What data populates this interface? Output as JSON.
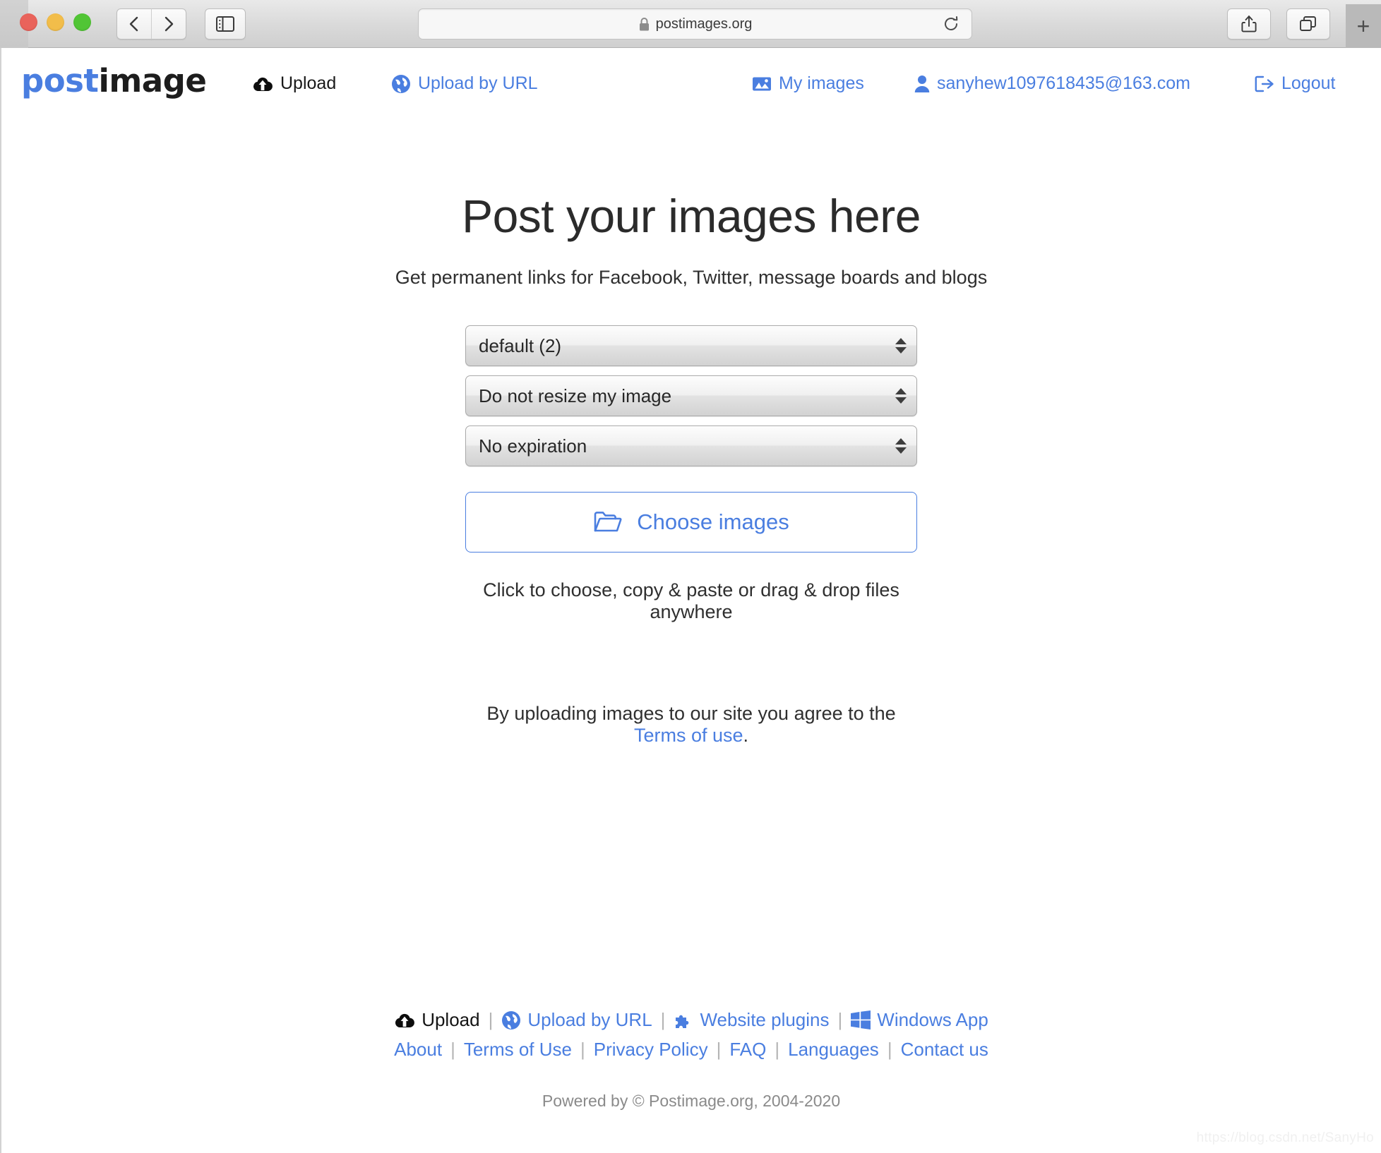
{
  "browser": {
    "url": "postimages.org",
    "lock_icon": "lock-icon",
    "reload_icon": "reload-icon",
    "back_icon": "chevron-left-icon",
    "forward_icon": "chevron-right-icon",
    "sidebar_icon": "sidebar-icon",
    "share_icon": "share-icon",
    "tabs_icon": "tab-overview-icon",
    "newtab_label": "+"
  },
  "header": {
    "logo_part1": "post",
    "logo_part2": "image",
    "nav": [
      {
        "label": "Upload",
        "icon": "cloud-upload-icon",
        "style": "black"
      },
      {
        "label": "Upload by URL",
        "icon": "globe-icon",
        "style": "blue"
      },
      {
        "label": "My images",
        "icon": "photo-icon",
        "style": "blue"
      },
      {
        "label": "sanyhew1097618435@163.com",
        "icon": "user-icon",
        "style": "blue"
      },
      {
        "label": "Logout",
        "icon": "logout-icon",
        "style": "blue"
      }
    ]
  },
  "main": {
    "title": "Post your images here",
    "subtitle": "Get permanent links for Facebook, Twitter, message boards and blogs",
    "selects": [
      {
        "name": "gallery-select",
        "value": "default (2)"
      },
      {
        "name": "resize-select",
        "value": "Do not resize my image"
      },
      {
        "name": "expiration-select",
        "value": "No expiration"
      }
    ],
    "choose_button": {
      "label": "Choose images",
      "icon": "open-folder-icon"
    },
    "drop_hint": "Click to choose, copy & paste or drag & drop files anywhere",
    "terms_prefix": "By uploading images to our site you agree to the ",
    "terms_link": "Terms of use",
    "terms_suffix": "."
  },
  "footer": {
    "row1": [
      {
        "label": "Upload",
        "icon": "cloud-upload-icon",
        "style": "black"
      },
      {
        "label": "Upload by URL",
        "icon": "globe-icon",
        "style": "blue"
      },
      {
        "label": "Website plugins",
        "icon": "puzzle-piece-icon",
        "style": "blue"
      },
      {
        "label": "Windows App",
        "icon": "windows-logo-icon",
        "style": "blue"
      }
    ],
    "row2": [
      "About",
      "Terms of Use",
      "Privacy Policy",
      "FAQ",
      "Languages",
      "Contact us"
    ],
    "separator": "|",
    "powered_by": "Powered by © Postimage.org, 2004-2020"
  },
  "watermark": "https://blog.csdn.net/SanyHo",
  "colors": {
    "brand_blue": "#4a7ee0",
    "text_dark": "#2b2b2b",
    "muted": "#8a8a8a"
  }
}
